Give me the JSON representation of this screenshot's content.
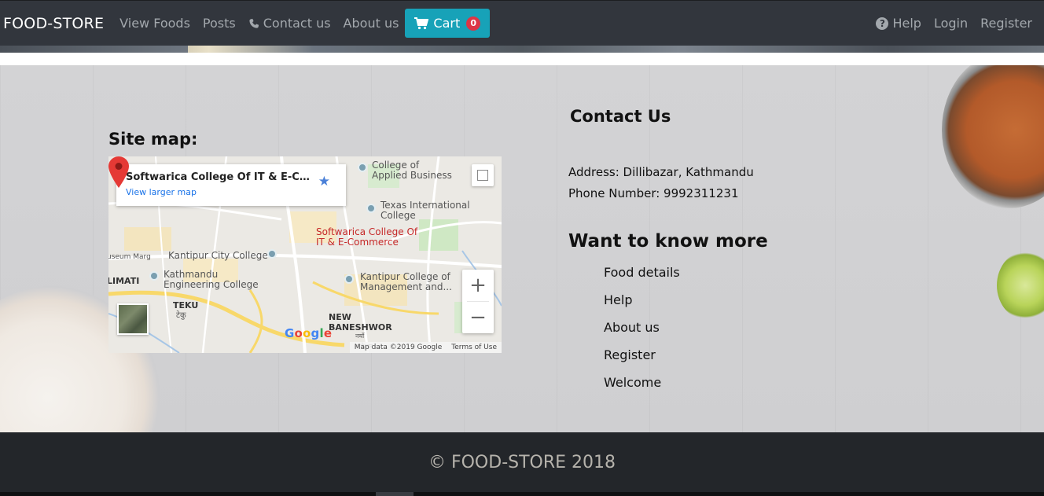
{
  "navbar": {
    "brand": "FOOD-STORE",
    "links": [
      "View Foods",
      "Posts",
      "Contact us",
      "About us"
    ],
    "cart": {
      "label": "Cart",
      "count": "0"
    },
    "right_links": [
      "Help",
      "Login",
      "Register"
    ]
  },
  "sitemap": {
    "title": "Site map:",
    "card": {
      "title": "Softwarica College Of IT & E-Comm...",
      "link": "View larger map"
    },
    "labels": {
      "applied": "College of\nApplied Business",
      "texas": "Texas International\nCollege",
      "softwarica": "Softwarica College Of\nIT & E-Commerce",
      "kantipur_city": "Kantipur City College",
      "museum": "useum Marg",
      "limati": "LIMATI",
      "kathmandu_eng": "Kathmandu\nEngineering College",
      "kantipur_mgmt": "Kantipur College of\nManagement and...",
      "teku": "TEKU",
      "teku_np": "टेकु",
      "new_baneshwor": "NEW\nBANESHWOR",
      "baneshwor_np": "नयाँ\nबानेश्वर"
    },
    "google": "Google",
    "map_data": "Map data ©2019 Google",
    "terms": "Terms of Use",
    "zoom_in": "+",
    "zoom_out": "−"
  },
  "contact": {
    "title": "Contact Us",
    "address": "Address: Dillibazar, Kathmandu",
    "phone": "Phone Number: 9992311231",
    "more_title": "Want to know more",
    "more_links": [
      "Food details",
      "Help",
      "About us",
      "Register",
      "Welcome"
    ]
  },
  "footer": {
    "text": "© FOOD-STORE 2018"
  },
  "colors": {
    "navbar_bg": "#32363d",
    "cart_bg": "#17a2b8",
    "badge_bg": "#dc3545",
    "footer_bg": "#23262a",
    "map_pin": "#e53935",
    "link_blue": "#1a73e8"
  }
}
